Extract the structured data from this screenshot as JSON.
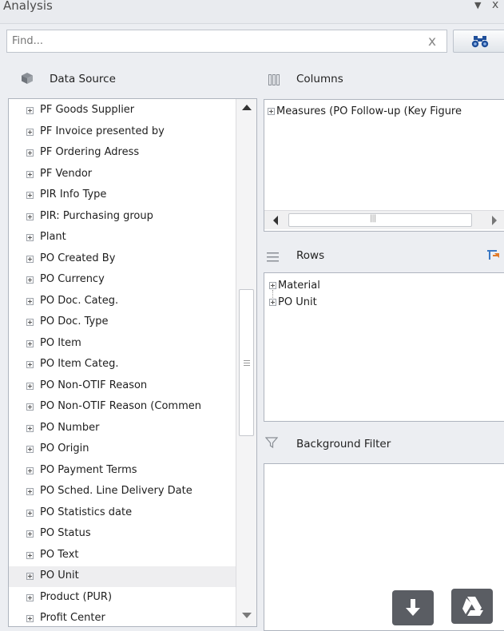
{
  "window": {
    "title": "Analysis",
    "menu_glyph": "▼",
    "close_glyph": "x"
  },
  "find": {
    "placeholder": "Find...",
    "clear_glyph": "x"
  },
  "data_source": {
    "heading": "Data Source",
    "items": [
      "PF Goods Supplier",
      "PF Invoice presented by",
      "PF Ordering Adress",
      "PF Vendor",
      "PIR Info Type",
      "PIR: Purchasing group",
      "Plant",
      "PO Created By",
      "PO Currency",
      "PO Doc. Categ.",
      "PO Doc. Type",
      "PO Item",
      "PO Item Categ.",
      "PO Non-OTIF Reason",
      "PO Non-OTIF Reason (Commen",
      "PO Number",
      "PO Origin",
      "PO Payment Terms",
      "PO Sched. Line Delivery Date",
      "PO Statistics date",
      "PO Status",
      "PO Text",
      "PO Unit",
      "Product (PUR)",
      "Profit Center"
    ],
    "selected": "PO Unit"
  },
  "columns": {
    "heading": "Columns",
    "items": [
      "Measures (PO Follow-up (Key Figure"
    ]
  },
  "rows": {
    "heading": "Rows",
    "items": [
      "Material",
      "PO Unit"
    ]
  },
  "background_filter": {
    "heading": "Background Filter"
  },
  "colors": {
    "accent": "#3a78c4",
    "button_dark": "#5a5d63",
    "panel_border": "#aeb4be"
  }
}
